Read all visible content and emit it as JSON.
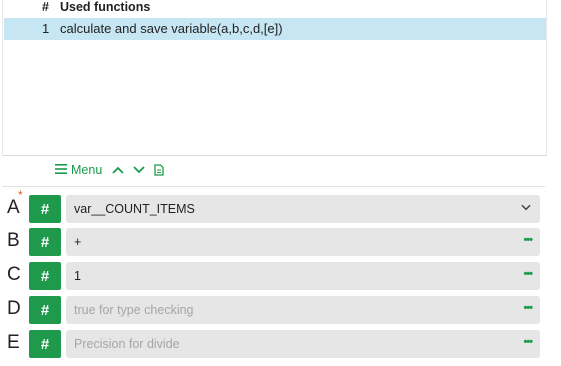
{
  "used_functions": {
    "hash_label": "#",
    "title": "Used functions",
    "rows": [
      {
        "num": "1",
        "text": "calculate and save variable(a,b,c,d,[e])"
      }
    ]
  },
  "menu": {
    "label": "Menu",
    "icons": [
      "hamburger-icon",
      "chevron-up-icon",
      "chevron-down-icon",
      "document-icon"
    ]
  },
  "params": [
    {
      "letter": "A",
      "required": true,
      "required_mark": "*",
      "type_symbol": "#",
      "value": "var__COUNT_ITEMS",
      "placeholder": "",
      "control": "dropdown"
    },
    {
      "letter": "B",
      "required": false,
      "type_symbol": "#",
      "value": "+",
      "placeholder": "",
      "control": "more"
    },
    {
      "letter": "C",
      "required": false,
      "type_symbol": "#",
      "value": "1",
      "placeholder": "",
      "control": "more"
    },
    {
      "letter": "D",
      "required": false,
      "type_symbol": "#",
      "value": "",
      "placeholder": "true for type checking",
      "control": "more"
    },
    {
      "letter": "E",
      "required": false,
      "type_symbol": "#",
      "value": "",
      "placeholder": "Precision for divide",
      "control": "more"
    }
  ],
  "more_glyph": "•••",
  "colors": {
    "accent_green": "#1f9a4c",
    "selected_row": "#c5e6f2",
    "field_bg": "#e6e6e6",
    "required_mark": "#e05a2a"
  }
}
